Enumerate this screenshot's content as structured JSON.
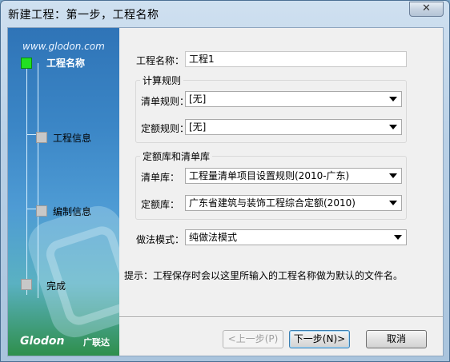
{
  "window": {
    "title": "新建工程：第一步，工程名称",
    "close_glyph": "✕"
  },
  "sidebar": {
    "website": "www.glodon.com",
    "steps": [
      {
        "label": "工程名称",
        "active": true
      },
      {
        "label": "工程信息",
        "active": false
      },
      {
        "label": "编制信息",
        "active": false
      },
      {
        "label": "完成",
        "active": false
      }
    ],
    "brand": "Glodon",
    "brand_cn": "广联达"
  },
  "form": {
    "project_name_label": "工程名称：",
    "project_name_value": "工程1",
    "calc_rules_group": "计算规则",
    "list_rule_label": "清单规则：",
    "list_rule_value": "[无]",
    "quota_rule_label": "定额规则：",
    "quota_rule_value": "[无]",
    "library_group": "定额库和清单库",
    "list_lib_label": "清单库：",
    "list_lib_value": "工程量清单项目设置规则(2010-广东)",
    "quota_lib_label": "定额库：",
    "quota_lib_value": "广东省建筑与装饰工程综合定额(2010)",
    "method_label": "做法模式：",
    "method_value": "纯做法模式",
    "hint": "提示：工程保存时会以这里所输入的工程名称做为默认的文件名。"
  },
  "buttons": {
    "prev": "<上一步(P)",
    "next": "下一步(N)>",
    "cancel": "取消"
  }
}
